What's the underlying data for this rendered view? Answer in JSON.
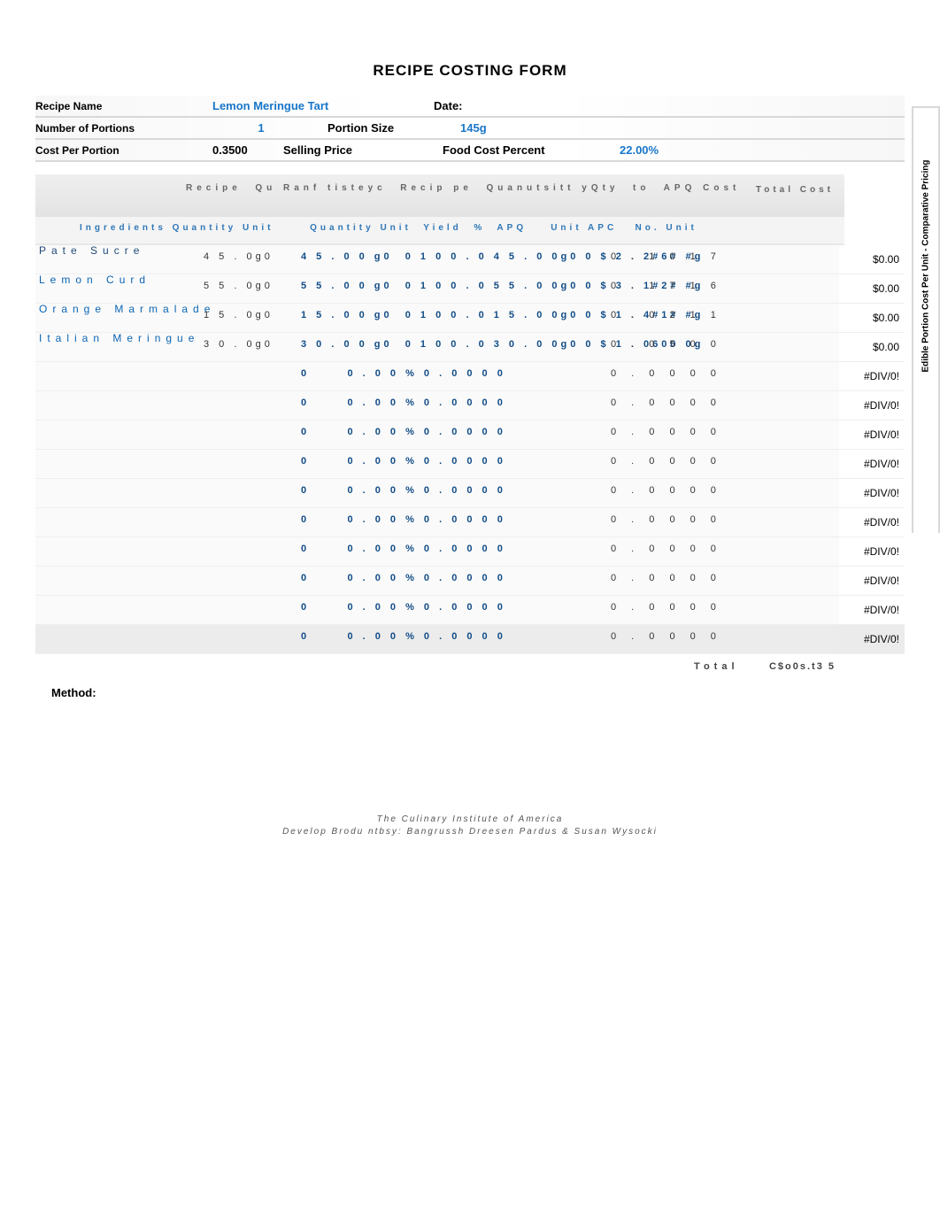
{
  "title": "RECIPE COSTING FORM",
  "recipe_name_label": "Recipe Name",
  "recipe_name": "Lemon Meringue Tart",
  "date_label": "Date:",
  "portions_label": "Number of Portions",
  "portions": "1",
  "portion_size_label": "Portion Size",
  "portion_size": "145g",
  "cost_per_portion_label": "Cost Per Portion",
  "cost_per_portion": "0.3500",
  "selling_price_label": "Selling Price",
  "food_cost_percent_label": "Food Cost Percent",
  "food_cost_percent": "22.00%",
  "vertical_label": "Edible Portion Cost Per Unit - Comparative Pricing",
  "header_main": "Recipe  Qu Ranf tisteyc  Recip pe  Quanutsitt yQty  to  APQ Cost",
  "header_total": "Total  Cost",
  "header_sub": "Ingredients Quantity Unit      Quantity Unit  Yield  %  APQ    Unit APC   No. Unit",
  "rows": [
    {
      "ing": "Pate Sucre",
      "ing_class": "pate",
      "qty": "4 5 . 0g0",
      "mid": "4 5 . 0 0 g0  0 1 0 0 . 0 4 5 . 0 0g0 0 $ 2 . 2#6# #g",
      "tot": "0 . 1 0 1 7",
      "right": "$0.00"
    },
    {
      "ing": "Lemon  Curd",
      "qty": "5 5 . 0g0",
      "mid": "5 5 . 0 0 g0  0 1 0 0 . 0 5 5 . 0 0g0 0 $ 3 . 1#2# #g",
      "tot": "0 . 1 7 1 6",
      "right": "$0.00"
    },
    {
      "ing": "Orange  Marmalade",
      "qty": "1 5 . 0g0",
      "mid": "1 5 . 0 0 g0  0 1 0 0 . 0 1 5 . 0 0g0 0 $ 1 . 4#1# #g",
      "tot": "0 . 0 2 1 1",
      "right": "$0.00"
    },
    {
      "ing": "Italian  Meringue",
      "qty": "3 0 . 0g0",
      "mid": "3 0 . 0 0 g0  0 1 0 0 . 0 3 0 . 0 0g0 0 $ 1 . 0600 0g",
      "tot": "0 . 0 5 0 0",
      "right": "$0.00"
    },
    {
      "ing": "",
      "qty": "",
      "mid": "0      0 . 0 0 % 0 . 0 0 0 0",
      "tot": "0 . 0 0 0 0",
      "right": "#DIV/0!"
    },
    {
      "ing": "",
      "qty": "",
      "mid": "0      0 . 0 0 % 0 . 0 0 0 0",
      "tot": "0 . 0 0 0 0",
      "right": "#DIV/0!"
    },
    {
      "ing": "",
      "qty": "",
      "mid": "0      0 . 0 0 % 0 . 0 0 0 0",
      "tot": "0 . 0 0 0 0",
      "right": "#DIV/0!"
    },
    {
      "ing": "",
      "qty": "",
      "mid": "0      0 . 0 0 % 0 . 0 0 0 0",
      "tot": "0 . 0 0 0 0",
      "right": "#DIV/0!"
    },
    {
      "ing": "",
      "qty": "",
      "mid": "0      0 . 0 0 % 0 . 0 0 0 0",
      "tot": "0 . 0 0 0 0",
      "right": "#DIV/0!"
    },
    {
      "ing": "",
      "qty": "",
      "mid": "0      0 . 0 0 % 0 . 0 0 0 0",
      "tot": "0 . 0 0 0 0",
      "right": "#DIV/0!"
    },
    {
      "ing": "",
      "qty": "",
      "mid": "0      0 . 0 0 % 0 . 0 0 0 0",
      "tot": "0 . 0 0 0 0",
      "right": "#DIV/0!"
    },
    {
      "ing": "",
      "qty": "",
      "mid": "0      0 . 0 0 % 0 . 0 0 0 0",
      "tot": "0 . 0 0 0 0",
      "right": "#DIV/0!"
    },
    {
      "ing": "",
      "qty": "",
      "mid": "0      0 . 0 0 % 0 . 0 0 0 0",
      "tot": "0 . 0 0 0 0",
      "right": "#DIV/0!"
    },
    {
      "ing": "",
      "qty": "",
      "mid": "0      0 . 0 0 % 0 . 0 0 0 0",
      "tot": "0 . 0 0 0 0",
      "right": "#DIV/0!",
      "end": true
    }
  ],
  "total_label": "Total",
  "total_value": "C$o0s.t3 5",
  "method_label": "Method:",
  "footer_line1": "The  Culinary  Institute  of  America",
  "footer_line2": "Develop Brodu ntbsy:  Bangrussh Dreesen  Pardus  &  Susan  Wysocki"
}
